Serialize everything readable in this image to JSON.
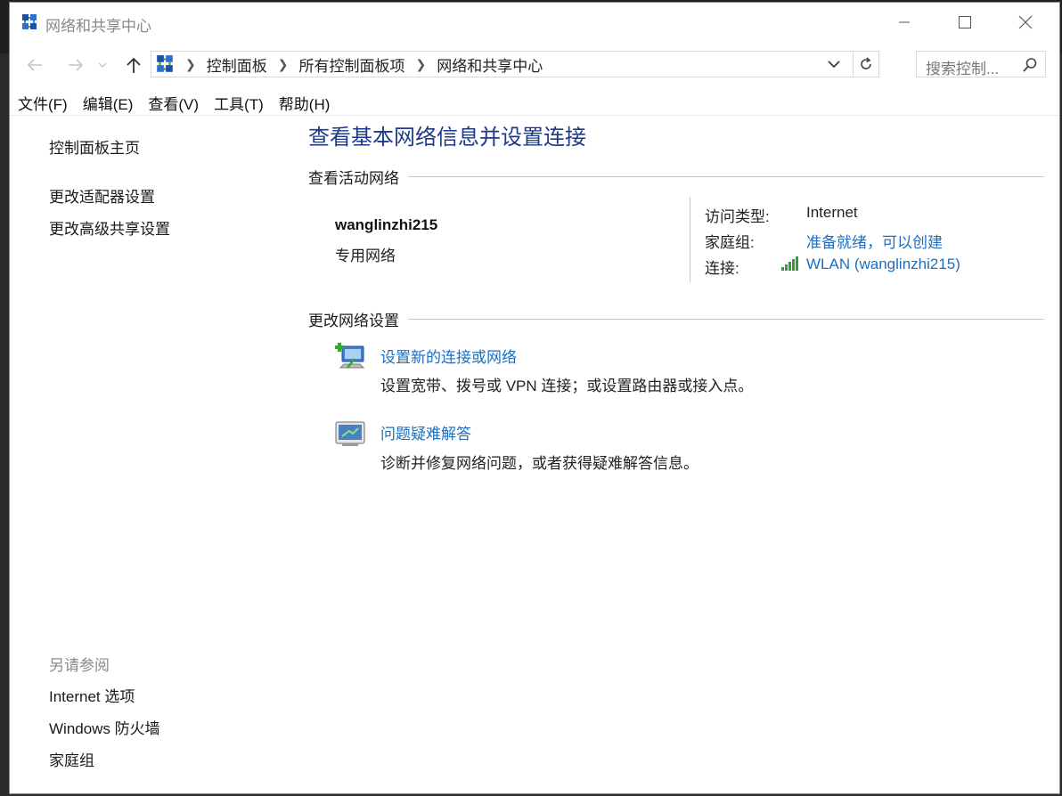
{
  "window": {
    "title": "网络和共享中心"
  },
  "nav": {
    "breadcrumbs": [
      "控制面板",
      "所有控制面板项",
      "网络和共享中心"
    ],
    "search_placeholder": "搜索控制..."
  },
  "menu": [
    "文件(F)",
    "编辑(E)",
    "查看(V)",
    "工具(T)",
    "帮助(H)"
  ],
  "sidebar": {
    "home": "控制面板主页",
    "links": [
      "更改适配器设置",
      "更改高级共享设置"
    ],
    "see_also_heading": "另请参阅",
    "see_also": [
      "Internet 选项",
      "Windows 防火墙",
      "家庭组"
    ]
  },
  "main": {
    "title": "查看基本网络信息并设置连接",
    "active_networks_heading": "查看活动网络",
    "network": {
      "name": "wanglinzhi215",
      "type": "专用网络",
      "access_type_label": "访问类型:",
      "access_type_value": "Internet",
      "homegroup_label": "家庭组:",
      "homegroup_value": "准备就绪，可以创建",
      "connections_label": "连接:",
      "connections_value": "WLAN (wanglinzhi215)"
    },
    "change_settings_heading": "更改网络设置",
    "tasks": [
      {
        "title": "设置新的连接或网络",
        "desc": "设置宽带、拨号或 VPN 连接；或设置路由器或接入点。",
        "icon": "new-connection-icon"
      },
      {
        "title": "问题疑难解答",
        "desc": "诊断并修复网络问题，或者获得疑难解答信息。",
        "icon": "troubleshoot-icon"
      }
    ]
  },
  "colors": {
    "link": "#1a6fc2",
    "title": "#1e3a8a"
  }
}
